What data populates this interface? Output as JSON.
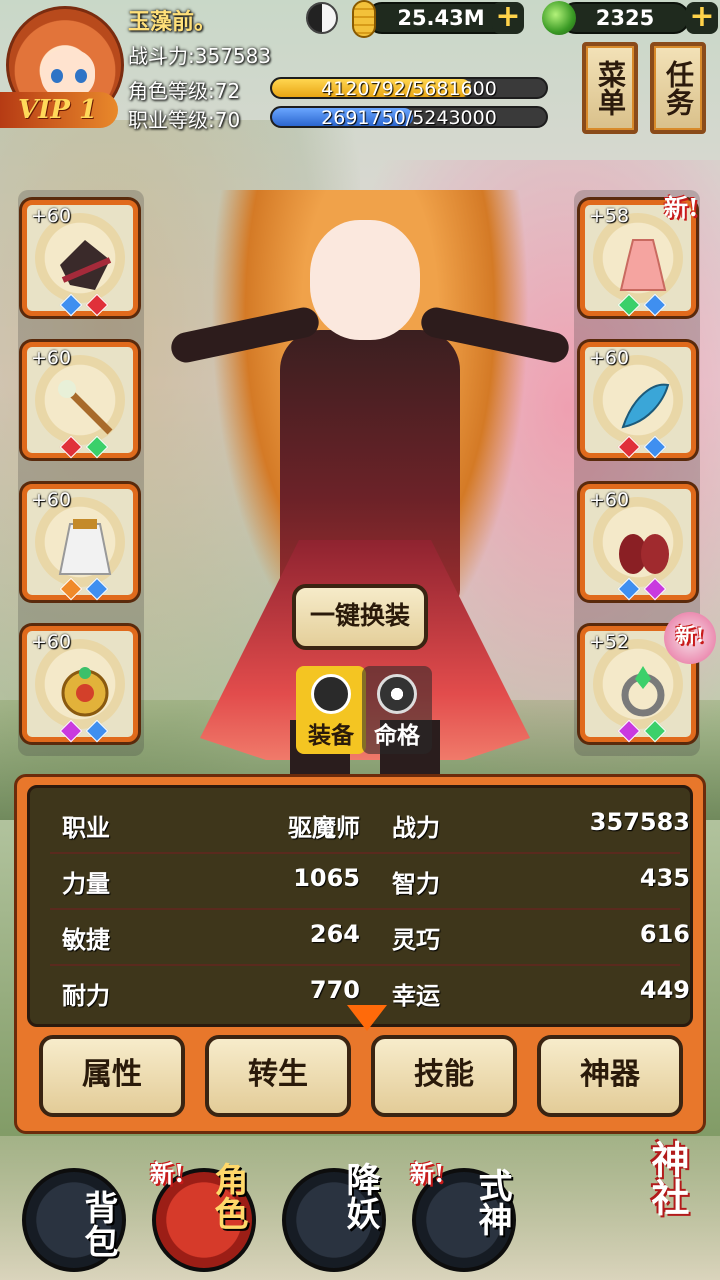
{
  "player": {
    "name": "玉藻前。",
    "vip": "VIP 1",
    "combat_power": "战斗力:357583",
    "role_level": "角色等级:72",
    "role_exp": "4120792/5681600",
    "role_exp_progress": 0.725,
    "job_level": "职业等级:70",
    "job_exp": "2691750/5243000",
    "job_exp_progress": 0.513
  },
  "currency": {
    "gold": "25.43M",
    "jade": "2325",
    "plus": "+"
  },
  "menu_buttons": {
    "menu": "菜单",
    "task": "任务"
  },
  "equipment": {
    "left": [
      {
        "level": "+60",
        "icon": "hat-icon"
      },
      {
        "level": "+60",
        "icon": "staff-icon"
      },
      {
        "level": "+60",
        "icon": "cape-icon"
      },
      {
        "level": "+60",
        "icon": "amulet-icon"
      }
    ],
    "right": [
      {
        "level": "+58",
        "icon": "dress-icon"
      },
      {
        "level": "+60",
        "icon": "feather-icon"
      },
      {
        "level": "+60",
        "icon": "shoes-icon"
      },
      {
        "level": "+52",
        "icon": "ring-icon"
      }
    ],
    "new_badge": "新!"
  },
  "actions": {
    "one_key_equip": "一键换装",
    "tab_equip": "装备",
    "tab_fate": "命格"
  },
  "stats": {
    "rows": [
      {
        "l_label": "职业",
        "l_value": "驱魔师",
        "r_label": "战力",
        "r_value": "357583"
      },
      {
        "l_label": "力量",
        "l_value": "1065",
        "r_label": "智力",
        "r_value": "435"
      },
      {
        "l_label": "敏捷",
        "l_value": "264",
        "r_label": "灵巧",
        "r_value": "616"
      },
      {
        "l_label": "耐力",
        "l_value": "770",
        "r_label": "幸运",
        "r_value": "449"
      }
    ],
    "tabs": [
      "属性",
      "转生",
      "技能",
      "神器"
    ]
  },
  "bottom_nav": {
    "bag": "背包",
    "role": "角色",
    "demon": "降妖",
    "shikigami": "式神",
    "shrine": "神社",
    "new_badge": "新!"
  },
  "colors": {
    "accent_orange": "#e8772b",
    "exp_yellow": "#f5b81f",
    "exp_blue": "#3c7fe0",
    "slot_border": "#e06a1c"
  }
}
